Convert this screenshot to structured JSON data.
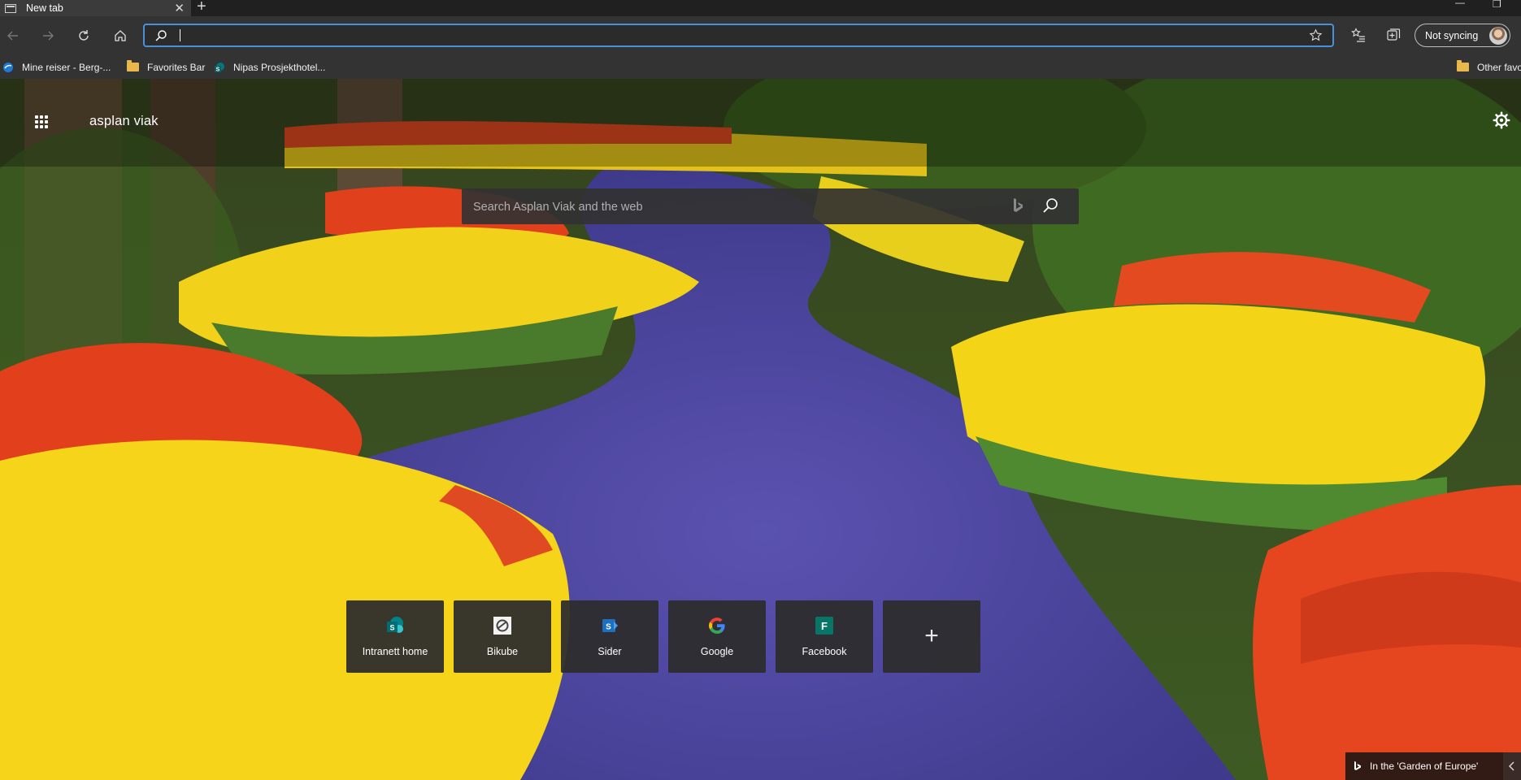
{
  "tab": {
    "title": "New tab"
  },
  "address": {
    "value": "",
    "placeholder": ""
  },
  "sync": {
    "label": "Not syncing"
  },
  "bookmarks": [
    {
      "label": "Mine reiser - Berg-..."
    },
    {
      "label": "Favorites Bar"
    },
    {
      "label": "Nipas Prosjekthotel..."
    },
    {
      "label": "Other favo"
    }
  ],
  "page": {
    "brand": "asplan viak",
    "search_placeholder": "Search Asplan Viak and the web",
    "tiles": [
      {
        "label": "Intranett home",
        "icon": "sharepoint-icon"
      },
      {
        "label": "Bikube",
        "icon": "bikube-icon"
      },
      {
        "label": "Sider",
        "icon": "sharepoint-sider-icon"
      },
      {
        "label": "Google",
        "icon": "google-icon"
      },
      {
        "label": "Facebook",
        "icon": "forms-icon",
        "glyph": "F"
      }
    ],
    "caption": "In the 'Garden of Europe'"
  },
  "colors": {
    "accent": "#4a90d9",
    "sharepoint": "#038387",
    "forms": "#077568",
    "google_blue": "#4285F4",
    "google_red": "#EA4335",
    "google_yellow": "#FBBC05",
    "google_green": "#34A853"
  }
}
